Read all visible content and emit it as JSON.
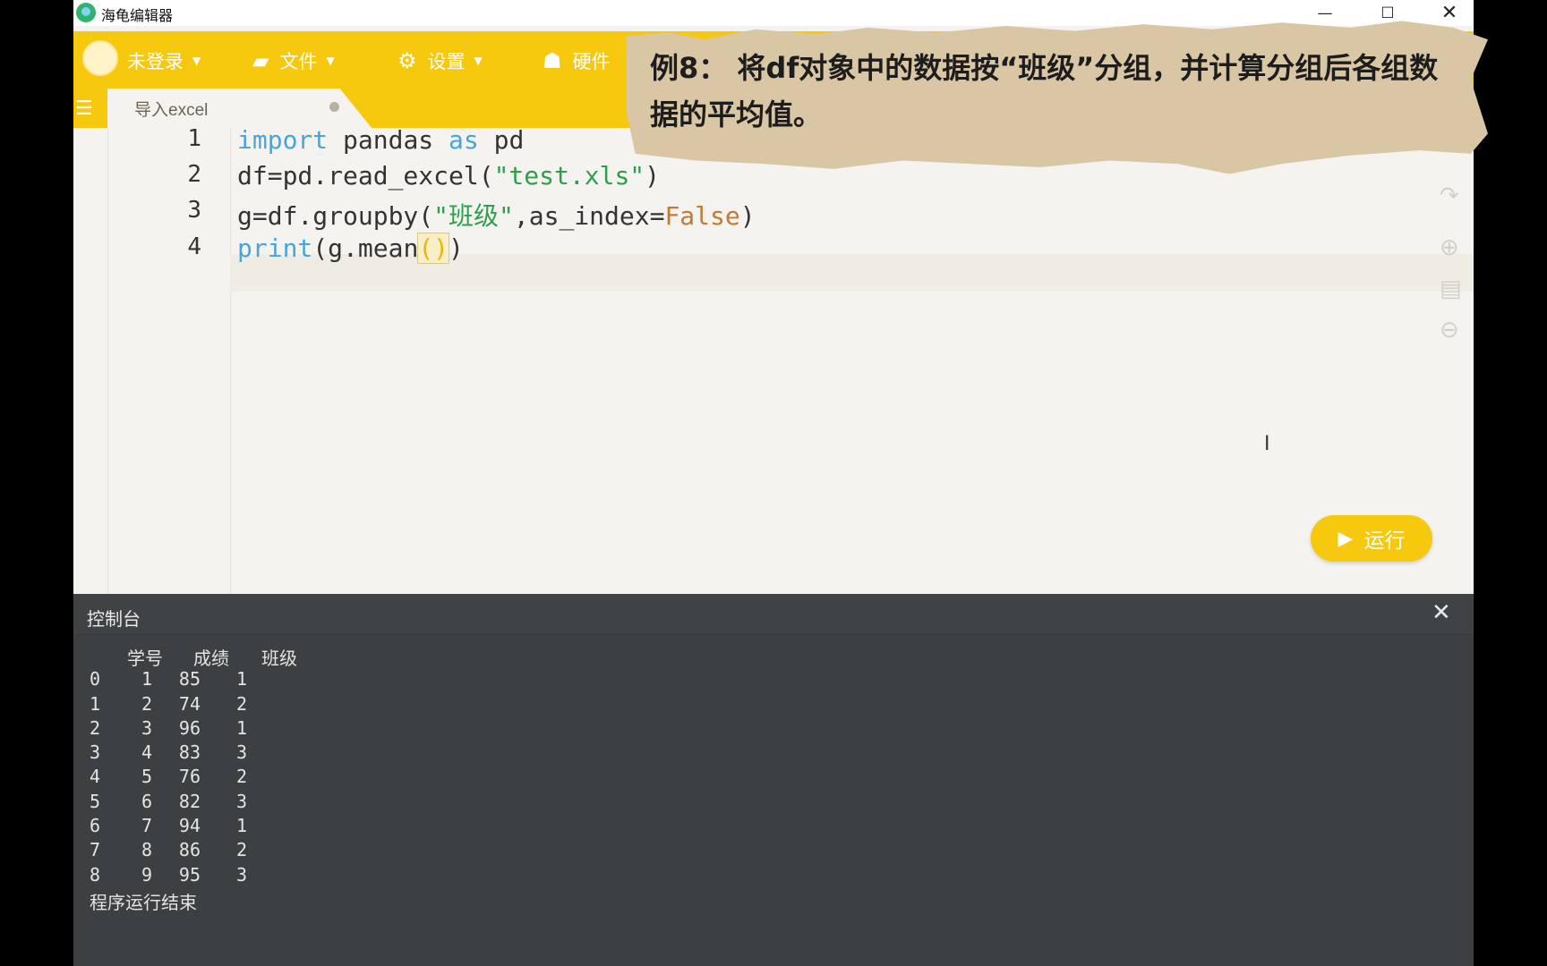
{
  "window": {
    "title": "海龟编辑器",
    "minimize_icon": "—",
    "maximize_icon": "☐",
    "close_icon": "✕"
  },
  "toolbar": {
    "login_label": "未登录",
    "file_label": "文件",
    "settings_label": "设置",
    "hardware_label": "硬件"
  },
  "tab": {
    "label": "导入excel"
  },
  "editor": {
    "line_numbers": [
      "1",
      "2",
      "3",
      "4"
    ]
  },
  "run_button": {
    "label": "运行"
  },
  "console": {
    "title": "控制台",
    "headers": [
      "学号",
      "成绩",
      "班级"
    ],
    "rows": [
      [
        "0",
        "1",
        "85",
        "1"
      ],
      [
        "1",
        "2",
        "74",
        "2"
      ],
      [
        "2",
        "3",
        "96",
        "1"
      ],
      [
        "3",
        "4",
        "83",
        "3"
      ],
      [
        "4",
        "5",
        "76",
        "2"
      ],
      [
        "5",
        "6",
        "82",
        "3"
      ],
      [
        "6",
        "7",
        "94",
        "1"
      ],
      [
        "7",
        "8",
        "86",
        "2"
      ],
      [
        "8",
        "9",
        "95",
        "3"
      ]
    ],
    "end_message": "程序运行结束"
  },
  "note": {
    "text": "例8： 将df对象中的数据按“班级”分组，并计算分组后各组数据的平均值。"
  },
  "colors": {
    "accent": "#f6c90e",
    "console_bg": "#3c4043",
    "keyword": "#46a5d9",
    "string": "#2e9f4b",
    "constant": "#c27a36"
  }
}
